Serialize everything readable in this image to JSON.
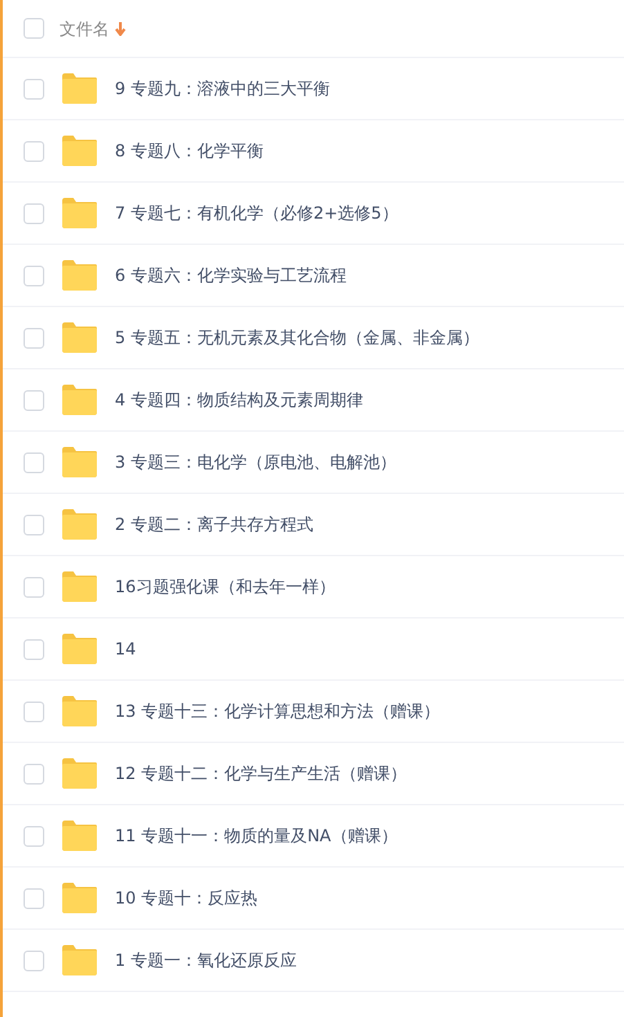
{
  "header": {
    "label": "文件名",
    "checked": false
  },
  "files": [
    {
      "name": "9 专题九：溶液中的三大平衡",
      "checked": false
    },
    {
      "name": "8 专题八：化学平衡",
      "checked": false
    },
    {
      "name": "7 专题七：有机化学（必修2+选修5）",
      "checked": false
    },
    {
      "name": "6 专题六：化学实验与工艺流程",
      "checked": false
    },
    {
      "name": "5 专题五：无机元素及其化合物（金属、非金属）",
      "checked": false
    },
    {
      "name": "4 专题四：物质结构及元素周期律",
      "checked": false
    },
    {
      "name": "3 专题三：电化学（原电池、电解池）",
      "checked": false
    },
    {
      "name": "2 专题二：离子共存方程式",
      "checked": false
    },
    {
      "name": "16习题强化课（和去年一样）",
      "checked": false
    },
    {
      "name": "14",
      "checked": false
    },
    {
      "name": "13 专题十三：化学计算思想和方法（赠课）",
      "checked": false
    },
    {
      "name": "12 专题十二：化学与生产生活（赠课）",
      "checked": false
    },
    {
      "name": "11 专题十一：物质的量及NA（赠课）",
      "checked": false
    },
    {
      "name": "10 专题十：反应热",
      "checked": false
    },
    {
      "name": "1 专题一：氧化还原反应",
      "checked": false
    }
  ]
}
